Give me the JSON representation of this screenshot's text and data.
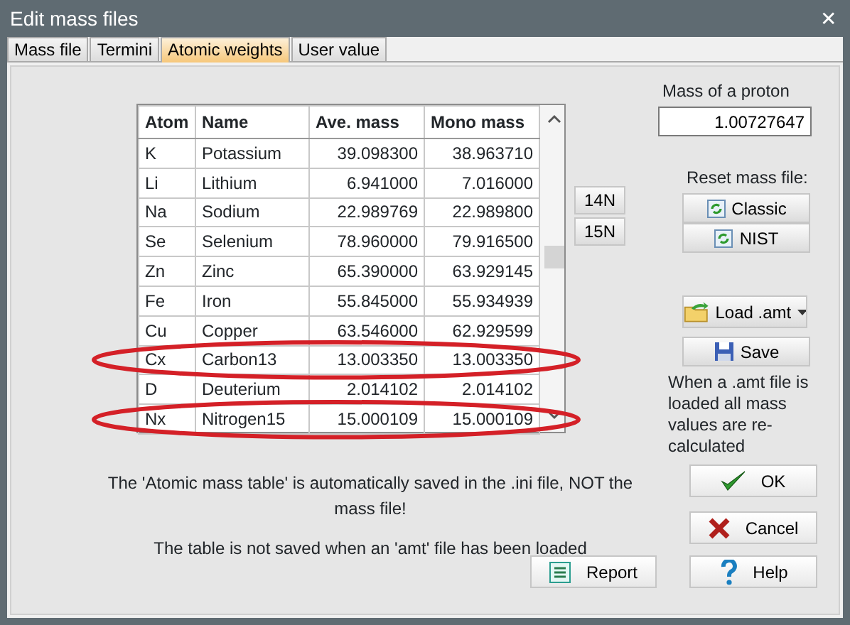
{
  "window": {
    "title": "Edit mass files",
    "close": "✕"
  },
  "tabs": [
    {
      "label": "Mass file",
      "selected": false
    },
    {
      "label": "Termini",
      "selected": false
    },
    {
      "label": "Atomic weights",
      "selected": true
    },
    {
      "label": "User value",
      "selected": false
    }
  ],
  "table": {
    "columns": [
      "Atom",
      "Name",
      "Ave. mass",
      "Mono mass"
    ],
    "rows": [
      {
        "cells": [
          "K",
          "Potassium",
          "39.098300",
          "38.963710"
        ],
        "highlighted": false
      },
      {
        "cells": [
          "Li",
          "Lithium",
          "6.941000",
          "7.016000"
        ],
        "highlighted": false
      },
      {
        "cells": [
          "Na",
          "Sodium",
          "22.989769",
          "22.989800"
        ],
        "highlighted": false
      },
      {
        "cells": [
          "Se",
          "Selenium",
          "78.960000",
          "79.916500"
        ],
        "highlighted": false
      },
      {
        "cells": [
          "Zn",
          "Zinc",
          "65.390000",
          "63.929145"
        ],
        "highlighted": false
      },
      {
        "cells": [
          "Fe",
          "Iron",
          "55.845000",
          "55.934939"
        ],
        "highlighted": false
      },
      {
        "cells": [
          "Cu",
          "Copper",
          "63.546000",
          "62.929599"
        ],
        "highlighted": false
      },
      {
        "cells": [
          "Cx",
          "Carbon13",
          "13.003350",
          "13.003350"
        ],
        "highlighted": true
      },
      {
        "cells": [
          "D",
          "Deuterium",
          "2.014102",
          "2.014102"
        ],
        "highlighted": false
      },
      {
        "cells": [
          "Nx",
          "Nitrogen15",
          "15.000109",
          "15.000109"
        ],
        "highlighted": true
      }
    ]
  },
  "isotope_buttons": [
    "14N",
    "15N"
  ],
  "proton": {
    "label": "Mass of a proton",
    "value": "1.00727647"
  },
  "reset": {
    "label": "Reset mass file:",
    "buttons": [
      "Classic",
      "NIST"
    ]
  },
  "load_button": "Load .amt",
  "save_button": "Save",
  "load_note": "When a .amt file is loaded all mass values are re-calculated",
  "notes": [
    "The 'Atomic mass table' is automatically saved in the .ini file, NOT the mass file!",
    "The table is not saved when an 'amt' file has been loaded"
  ],
  "buttons": [
    {
      "kind": "ok",
      "label": "OK"
    },
    {
      "kind": "cancel",
      "label": "Cancel"
    },
    {
      "kind": "report",
      "label": "Report"
    },
    {
      "kind": "help",
      "label": "Help"
    }
  ]
}
